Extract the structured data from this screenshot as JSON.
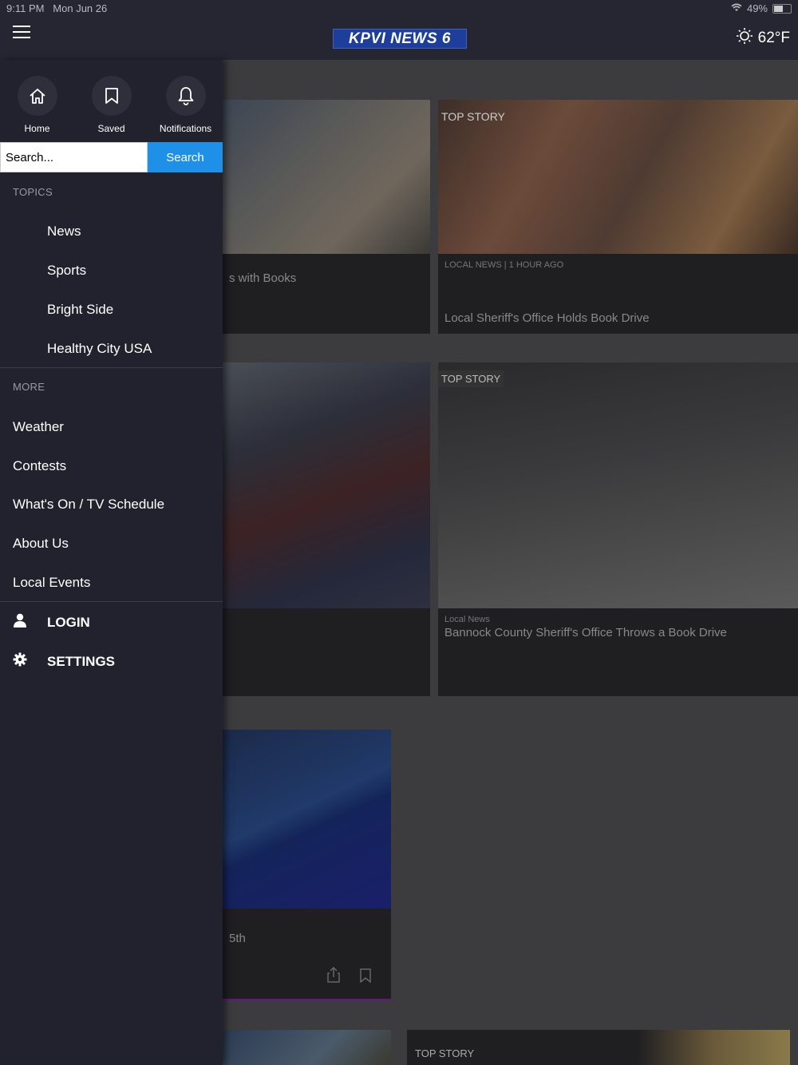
{
  "status": {
    "time": "9:11 PM",
    "date": "Mon Jun 26",
    "battery": "49%"
  },
  "header": {
    "logo": "KPVI NEWS 6",
    "temperature": "62°F"
  },
  "drawer": {
    "quick": [
      {
        "label": "Home",
        "icon": "home-icon"
      },
      {
        "label": "Saved",
        "icon": "bookmark-icon"
      },
      {
        "label": "Notifications",
        "icon": "bell-icon"
      }
    ],
    "search": {
      "placeholder": "Search...",
      "value": "Search...",
      "button": "Search"
    },
    "topics_label": "TOPICS",
    "topics": [
      "News",
      "Sports",
      "Bright Side",
      "Healthy City USA"
    ],
    "more_label": "MORE",
    "more": [
      "Weather",
      "Contests",
      "What's On / TV Schedule",
      "About Us",
      "Local Events"
    ],
    "login": "LOGIN",
    "settings": "SETTINGS"
  },
  "cards": {
    "c1": {
      "title": "s with Books"
    },
    "c2": {
      "badge": "TOP STORY",
      "meta": "LOCAL NEWS | 1 HOUR AGO",
      "title": "Local Sheriff's Office Holds Book Drive"
    },
    "c4": {
      "badge": "TOP STORY",
      "meta": "Local News",
      "title": "Bannock County Sheriff's Office Throws a Book Drive"
    },
    "c5": {
      "title": "5th"
    },
    "c7": {
      "badge": "TOP STORY"
    }
  }
}
